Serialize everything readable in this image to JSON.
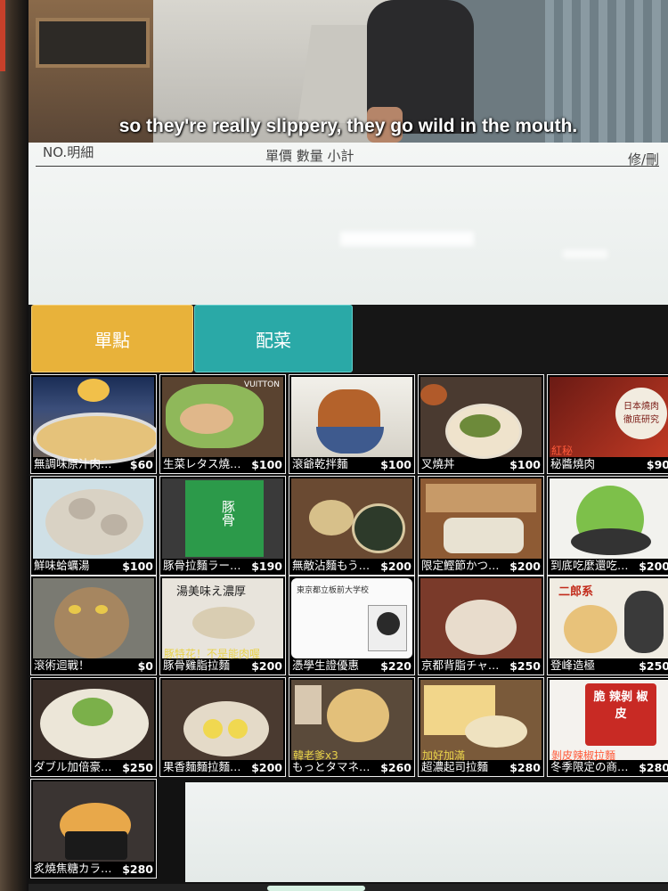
{
  "subtitle": "so they're really slippery, they go wild in the mouth.",
  "order_header": {
    "no_detail": "NO.明細",
    "columns": "單價 數量 小計",
    "edit_delete": "修/刪"
  },
  "tabs": {
    "single": "單點",
    "side": "配菜"
  },
  "items": [
    {
      "name": "無調味原汁肉…",
      "price": "$60"
    },
    {
      "name": "生菜レタス燒…",
      "price": "$100"
    },
    {
      "name": "滾爺乾拌麵",
      "price": "$100"
    },
    {
      "name": "叉燒丼",
      "price": "$100"
    },
    {
      "name": "秘醬燒肉",
      "price": "$90"
    },
    {
      "name": "鮮味蛤蠣湯",
      "price": "$100"
    },
    {
      "name": "豚骨拉麵ラー…",
      "price": "$190"
    },
    {
      "name": "無敵沾麵もう…",
      "price": "$200"
    },
    {
      "name": "限定鰹節かつ…",
      "price": "$200"
    },
    {
      "name": "到底吃麼還吃…",
      "price": "$200"
    },
    {
      "name": "滾術迴戰！",
      "price": "$0"
    },
    {
      "name": "豚骨雞脂拉麵",
      "price": "$200"
    },
    {
      "name": "憑學生證優惠",
      "price": "$220"
    },
    {
      "name": "京都背脂チャ…",
      "price": "$250"
    },
    {
      "name": "登峰造極",
      "price": "$250"
    },
    {
      "name": "ダブル加倍豪…",
      "price": "$250"
    },
    {
      "name": "果香麵麵拉麵…",
      "price": "$200"
    },
    {
      "name": "もっとタマネ…",
      "price": "$260"
    },
    {
      "name": "超濃起司拉麵",
      "price": "$280"
    },
    {
      "name": "冬季限定の商…",
      "price": "$280"
    },
    {
      "name": "炙燒焦糖カラ…",
      "price": "$280"
    }
  ],
  "photo_texts": {
    "item2_brand": "VUITTON",
    "item5_badge": "日本燒肉 徹底研究",
    "item5_tag": "紅秘",
    "item7_sign": "豚骨",
    "item12_sign": "湯美味え濃厚",
    "item12_tag": "豚特花！不是能肉喔",
    "item13_card": "東京都立板前大学校",
    "item15_sign": "二郎系",
    "item18_tag": "韓老爹x3",
    "item19_tag": "加好加滿",
    "item20_sign": "脆 辣剝 椒皮",
    "item20_tag": "剝皮辣椒拉麵"
  },
  "colors": {
    "tab_single": "#e8b23a",
    "tab_side": "#2aa9a7"
  }
}
